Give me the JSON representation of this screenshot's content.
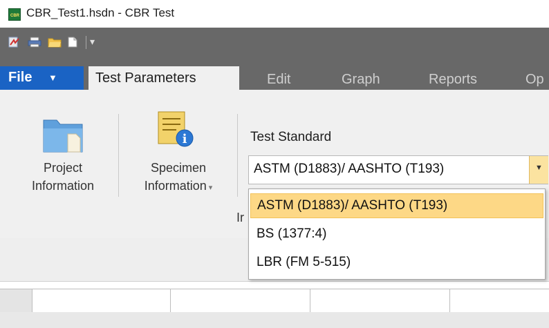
{
  "window": {
    "title": "CBR_Test1.hsdn - CBR Test",
    "app_icon_text": "CBR"
  },
  "quick_access": {
    "icons": [
      "specimen-report-icon",
      "print-icon",
      "open-folder-icon",
      "new-document-icon",
      "customize-dropdown-icon"
    ]
  },
  "ribbon_tabs": {
    "file_label": "File",
    "tabs": [
      "Test Parameters",
      "Edit",
      "Graph",
      "Reports",
      "Op"
    ]
  },
  "ribbon": {
    "project_line1": "Project",
    "project_line2": "Information",
    "specimen_line1": "Specimen",
    "specimen_line2": "Information",
    "test_standard_label": "Test Standard",
    "test_standard_value": "ASTM (D1883)/ AASHTO (T193)",
    "group_caption": "Ir"
  },
  "dropdown": {
    "options": [
      "ASTM (D1883)/ AASHTO (T193)",
      "BS (1377:4)",
      "LBR (FM 5-515)"
    ],
    "selected_index": 0
  },
  "colors": {
    "file_button": "#1a63c4",
    "toolbar": "#686868",
    "highlight": "#fdd886"
  }
}
